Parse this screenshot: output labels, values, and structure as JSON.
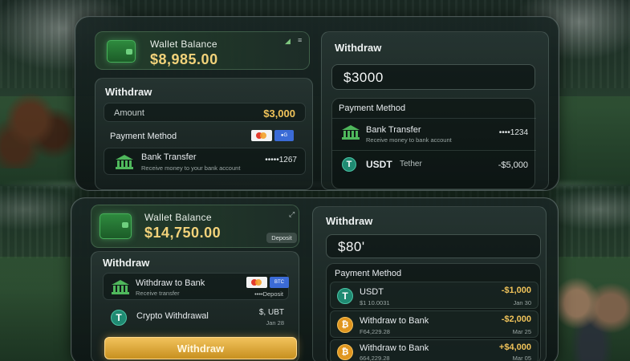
{
  "top": {
    "wallet": {
      "label": "Wallet  Balance",
      "amount": "$8,985.00"
    },
    "left": {
      "title": "Withdraw",
      "amount_label": "Amount",
      "amount_value": "$3,000",
      "payment_method": "Payment Method",
      "bank": {
        "label": "Bank Transfer",
        "sub": "Receive money to your bank account",
        "value": "•••••1267"
      }
    },
    "right": {
      "title": "Withdraw",
      "input_value": "$3000",
      "payment_method": "Payment Method",
      "bank": {
        "label": "Bank Transfer",
        "sub": "Receive money to bank account",
        "value": "••••1234"
      },
      "usdt": {
        "label": "USDT",
        "label2": "Tether",
        "value": "-$5,000"
      }
    }
  },
  "bottom": {
    "wallet": {
      "label": "Wallet  Balance",
      "amount": "$14,750.00",
      "deposit": "Deposit"
    },
    "left": {
      "title": "Withdraw",
      "bank": {
        "label": "Withdraw to Bank",
        "sub": "Receive transfer",
        "value": "••••Deposit"
      },
      "crypto": {
        "label": "Crypto Withdrawal",
        "value": "$, UBT",
        "date": "Jan 28"
      },
      "button": "Withdraw"
    },
    "right": {
      "title": "Withdraw",
      "input_value": "$80'",
      "payment_method": "Payment Method",
      "items": [
        {
          "label": "USDT",
          "sub": "$1 10.0031",
          "value": "-$1,000",
          "date": "Jan 30"
        },
        {
          "label": "Withdraw to Bank",
          "sub": "F64,229.28",
          "value": "-$2,000",
          "date": "Mar 25"
        },
        {
          "label": "Withdraw to Bank",
          "sub": "664,229.28",
          "value": "+$4,000",
          "date": "Mar 05"
        }
      ]
    }
  }
}
